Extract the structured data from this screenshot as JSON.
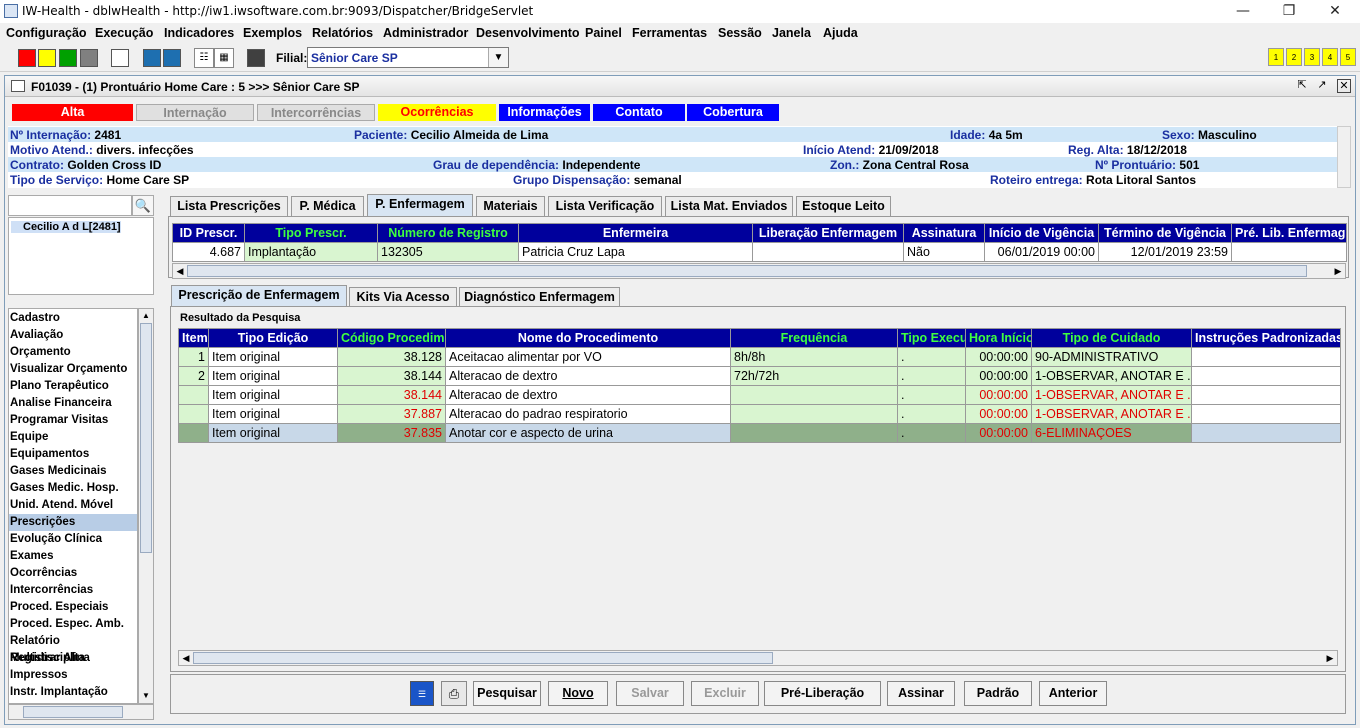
{
  "window": {
    "title": "IW-Health - dblwHealth - http://iw1.iwsoftware.com.br:9093/Dispatcher/BridgeServlet"
  },
  "menu": [
    "Configuração",
    "Execução",
    "Indicadores",
    "Exemplos",
    "Relatórios",
    "Administrador",
    "Desenvolvimento",
    "Painel",
    "Ferramentas",
    "Sessão",
    "Janela",
    "Ajuda"
  ],
  "toolbar": {
    "filial_label": "Filial:",
    "filial_value": "Sênior Care SP",
    "num_buttons": [
      "1",
      "2",
      "3",
      "4",
      "5"
    ],
    "swatches": [
      "#ff0000",
      "#ffff00",
      "#00a000",
      "#808080",
      "#ffffff",
      "#1e6fb0",
      "#1e6fb0",
      "#404040"
    ]
  },
  "frame": {
    "title": "F01039 - (1) Prontuário Home Care : 5 >>> Sênior Care SP"
  },
  "status_buttons": [
    {
      "label": "Alta",
      "bg": "#ff0000",
      "fg": "#ffffff"
    },
    {
      "label": "Internação",
      "bg": "#e0e0e0",
      "fg": "#888888"
    },
    {
      "label": "Intercorrências",
      "bg": "#e0e0e0",
      "fg": "#888888"
    },
    {
      "label": "Ocorrências",
      "bg": "#ffff00",
      "fg": "#ff0000"
    },
    {
      "label": "Informações",
      "bg": "#0000ff",
      "fg": "#ffffff"
    },
    {
      "label": "Contato",
      "bg": "#0000ff",
      "fg": "#ffffff"
    },
    {
      "label": "Cobertura",
      "bg": "#0000ff",
      "fg": "#ffffff"
    }
  ],
  "info": {
    "internacao_label": "Nº Internação:",
    "internacao": "2481",
    "paciente_label": "Paciente:",
    "paciente": "Cecilio Almeida de Lima",
    "idade_label": "Idade:",
    "idade": "4a 5m",
    "sexo_label": "Sexo:",
    "sexo": "Masculino",
    "motivo_label": "Motivo Atend.:",
    "motivo": "divers. infecções",
    "inicio_label": "Início Atend:",
    "inicio": "21/09/2018",
    "regalta_label": "Reg. Alta:",
    "regalta": "18/12/2018",
    "contrato_label": "Contrato:",
    "contrato": "Golden Cross ID",
    "grau_label": "Grau de dependência:",
    "grau": "Independente",
    "zona_label": "Zon.:",
    "zona": "Zona Central Rosa",
    "prontuario_label": "Nº Prontuário:",
    "prontuario": "501",
    "servico_label": "Tipo de Serviço:",
    "servico": "Home Care SP",
    "grupo_label": "Grupo Dispensação:",
    "grupo": "semanal",
    "roteiro_label": "Roteiro entrega:",
    "roteiro": "Rota Litoral Santos"
  },
  "patient_item": "Cecilio A d L[2481]",
  "side_menu": [
    "Cadastro",
    "Avaliação",
    "Orçamento",
    "Visualizar Orçamento",
    "Plano Terapêutico",
    "Analise Financeira",
    "Programar Visitas",
    "Equipe",
    "Equipamentos",
    "Gases Medicinais",
    "Gases Medic. Hosp.",
    "Unid. Atend. Móvel",
    "Prescrições",
    "Evolução Clínica",
    "Exames",
    "Ocorrências",
    "Intercorrências",
    "Proced. Especiais",
    "Proced. Espec. Amb.",
    "Relatório Multidisciplina",
    "Registrar Alta",
    "Impressos",
    "Instr. Implantação"
  ],
  "side_selected": 12,
  "tabs1": [
    "Lista Prescrições",
    "P. Médica",
    "P. Enfermagem",
    "Materiais",
    "Lista Verificação",
    "Lista Mat. Enviados",
    "Estoque Leito"
  ],
  "tabs1_selected": 2,
  "presc_table": {
    "headers": [
      "ID Prescr.",
      "Tipo Prescr.",
      "Número de Registro",
      "Enfermeira",
      "Liberação Enfermagem",
      "Assinatura",
      "Início de Vigência",
      "Término de Vigência",
      "Pré. Lib. Enfermag"
    ],
    "rows": [
      [
        "4.687",
        "Implantação",
        "132305",
        "Patricia Cruz Lapa",
        "",
        "Não",
        "06/01/2019 00:00",
        "12/01/2019 23:59",
        ""
      ]
    ]
  },
  "tabs2": [
    "Prescrição de Enfermagem",
    "Kits Via Acesso",
    "Diagnóstico Enfermagem"
  ],
  "tabs2_selected": 0,
  "result_title": "Resultado da Pesquisa",
  "proc_table": {
    "headers": [
      "Item",
      "Tipo Edição",
      "Código Procedime",
      "Nome do Procedimento",
      "Frequência",
      "Tipo Execu",
      "Hora Início",
      "Tipo de Cuidado",
      "Instruções Padronizadas"
    ],
    "rows": [
      {
        "item": "1",
        "tipo": "Item original",
        "codigo": "38.128",
        "nome": "Aceitacao alimentar por VO",
        "freq": "8h/8h",
        "exec": ".",
        "hora": "00:00:00",
        "cuidado": "90-ADMINISTRATIVO",
        "instr": "",
        "red": false
      },
      {
        "item": "2",
        "tipo": "Item original",
        "codigo": "38.144",
        "nome": "Alteracao de dextro",
        "freq": "72h/72h",
        "exec": ".",
        "hora": "00:00:00",
        "cuidado": "1-OBSERVAR, ANOTAR E ...",
        "instr": "",
        "red": false
      },
      {
        "item": "",
        "tipo": "Item original",
        "codigo": "38.144",
        "nome": "Alteracao de dextro",
        "freq": "",
        "exec": ".",
        "hora": "00:00:00",
        "cuidado": "1-OBSERVAR, ANOTAR E ...",
        "instr": "",
        "red": true
      },
      {
        "item": "",
        "tipo": "Item original",
        "codigo": "37.887",
        "nome": "Alteracao do padrao respiratorio",
        "freq": "",
        "exec": ".",
        "hora": "00:00:00",
        "cuidado": "1-OBSERVAR, ANOTAR E ...",
        "instr": "",
        "red": true
      },
      {
        "item": "",
        "tipo": "Item original",
        "codigo": "37.835",
        "nome": "Anotar cor e aspecto de urina",
        "freq": "",
        "exec": ".",
        "hora": "00:00:00",
        "cuidado": "6-ELIMINAÇOES",
        "instr": "",
        "red": true,
        "selected": true
      }
    ]
  },
  "bottom_buttons": [
    {
      "label": "Pesquisar",
      "enabled": true
    },
    {
      "label": "Novo",
      "enabled": true
    },
    {
      "label": "Salvar",
      "enabled": false
    },
    {
      "label": "Excluir",
      "enabled": false
    },
    {
      "label": "Pré-Liberação",
      "enabled": true
    },
    {
      "label": "Assinar",
      "enabled": true
    },
    {
      "label": "Padrão",
      "enabled": true
    },
    {
      "label": "Anterior",
      "enabled": true
    }
  ]
}
